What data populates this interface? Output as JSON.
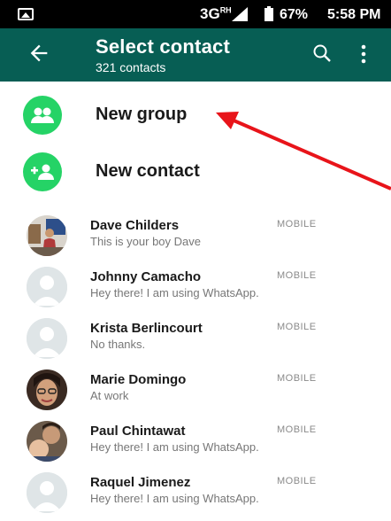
{
  "status_bar": {
    "network": "3G",
    "network_sup": "RH",
    "battery": "67%",
    "time": "5:58 PM"
  },
  "toolbar": {
    "title": "Select contact",
    "subtitle": "321 contacts"
  },
  "actions": [
    {
      "label": "New group",
      "icon": "group-icon"
    },
    {
      "label": "New contact",
      "icon": "add-contact-icon"
    }
  ],
  "contacts": [
    {
      "name": "Dave Childers",
      "status": "This is your boy Dave",
      "type": "MOBILE",
      "avatar": "photo"
    },
    {
      "name": "Johnny Camacho",
      "status": "Hey there! I am using WhatsApp.",
      "type": "MOBILE",
      "avatar": "default"
    },
    {
      "name": "Krista Berlincourt",
      "status": "No thanks.",
      "type": "MOBILE",
      "avatar": "default"
    },
    {
      "name": "Marie Domingo",
      "status": "At work",
      "type": "MOBILE",
      "avatar": "photo"
    },
    {
      "name": "Paul Chintawat",
      "status": "Hey there! I am using WhatsApp.",
      "type": "MOBILE",
      "avatar": "photo"
    },
    {
      "name": "Raquel Jimenez",
      "status": "Hey there! I am using WhatsApp.",
      "type": "MOBILE",
      "avatar": "default"
    }
  ],
  "colors": {
    "toolbar": "#075e54",
    "accent": "#25d366",
    "annotation_arrow": "#e8141a"
  }
}
